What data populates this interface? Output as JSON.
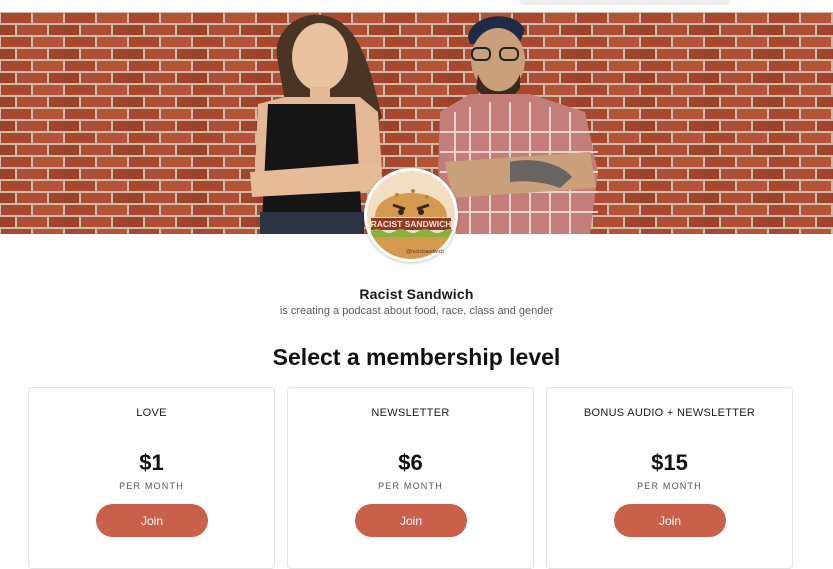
{
  "creator": {
    "name": "Racist Sandwich",
    "description": "is creating a podcast about food, race, class and gender",
    "avatar_label": "RACIST SANDWICH",
    "avatar_handle": "@racistsandwich"
  },
  "page": {
    "section_title": "Select a membership level"
  },
  "tiers": [
    {
      "name": "LOVE",
      "price": "$1",
      "period": "PER MONTH",
      "button": "Join"
    },
    {
      "name": "NEWSLETTER",
      "price": "$6",
      "period": "PER MONTH",
      "button": "Join"
    },
    {
      "name": "BONUS AUDIO + NEWSLETTER",
      "price": "$15",
      "period": "PER MONTH",
      "button": "Join"
    }
  ],
  "colors": {
    "accent": "#c8604a",
    "brick": "#a84a35",
    "mortar": "#c9b9a8"
  }
}
